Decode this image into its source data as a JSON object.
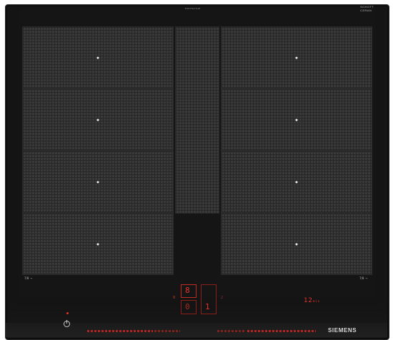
{
  "product": {
    "brand": "SIEMENS",
    "top_center_label": "EX675LYC1E",
    "glass_logo_line1": "SCHOTT",
    "glass_logo_line2": "CERAN",
    "glass_logo_sub": "",
    "left_corner_mark": "7/8 ⊸",
    "right_corner_mark": "7/8 ⊸"
  },
  "control_panel": {
    "power_level_upper": "8",
    "power_level_lower": "0",
    "display_right": "1",
    "timer_value": "12",
    "timer_unit": "min",
    "timer_sub": "",
    "left_indicator": "8",
    "right_indicator": "2"
  },
  "zones": {
    "left_count": 4,
    "right_count": 4,
    "center_panel": "flex"
  },
  "colors": {
    "glass": "#151515",
    "zone_fill": "#3a3a3a",
    "display_red": "#e8342b",
    "brand_text": "#d8d8d8"
  }
}
